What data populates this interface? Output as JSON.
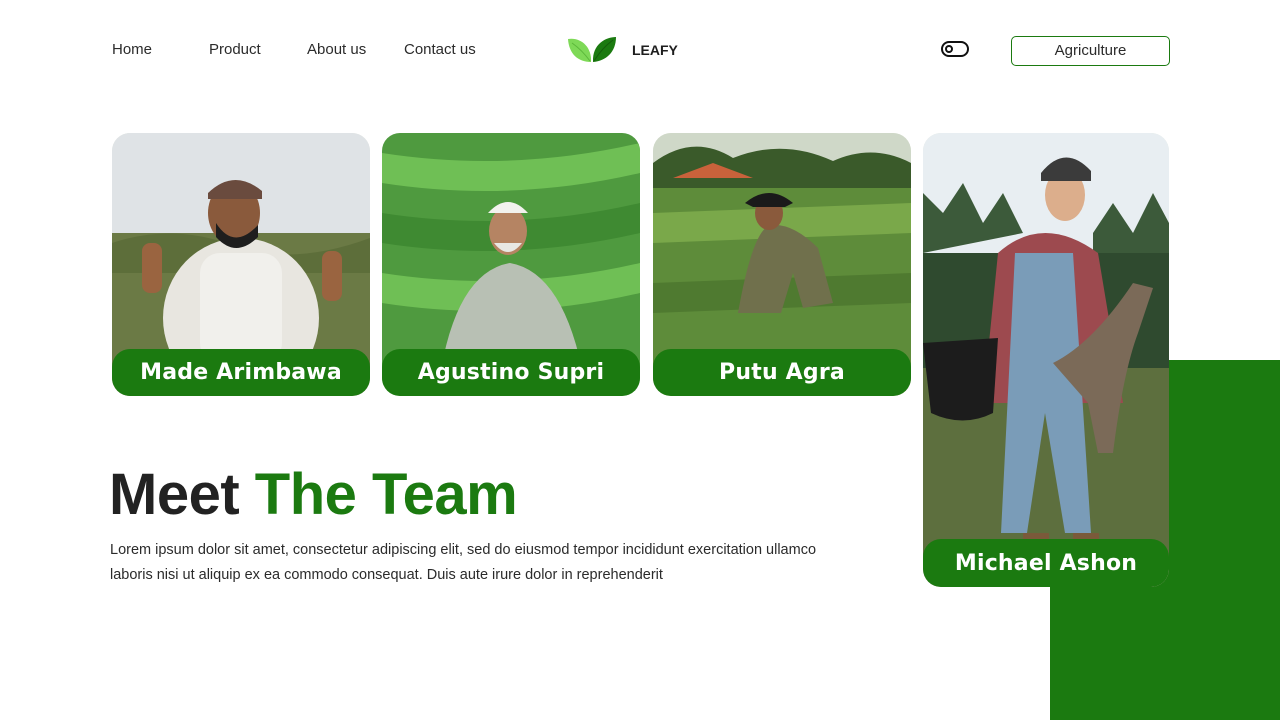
{
  "nav": {
    "links": [
      "Home",
      "Product",
      "About us",
      "Contact us"
    ],
    "brand": "LEAFY",
    "category_button": "Agriculture",
    "theme_toggle_icon": "toggle-icon",
    "logo_icon": "leaf-logo-icon"
  },
  "team": {
    "members": [
      {
        "name": "Made Arimbawa"
      },
      {
        "name": "Agustino Supri"
      },
      {
        "name": "Putu Agra"
      },
      {
        "name": "Michael Ashon"
      }
    ]
  },
  "hero": {
    "title_dark": "Meet",
    "title_accent": "The Team",
    "description": "Lorem ipsum dolor sit amet, consectetur adipiscing elit, sed do eiusmod tempor incididunt exercitation ullamco laboris nisi ut aliquip ex ea commodo consequat. Duis aute irure dolor in reprehenderit"
  },
  "colors": {
    "accent": "#1b7a10",
    "text": "#222222",
    "background": "#ffffff"
  }
}
